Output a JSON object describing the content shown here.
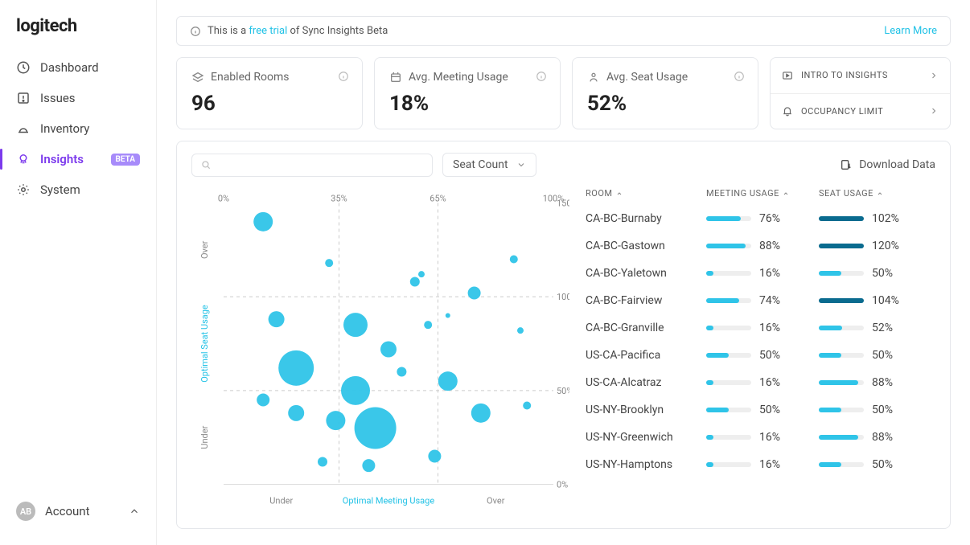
{
  "brand": "logitech",
  "sidebar": {
    "items": [
      {
        "label": "Dashboard",
        "icon": "dashboard-icon"
      },
      {
        "label": "Issues",
        "icon": "issues-icon"
      },
      {
        "label": "Inventory",
        "icon": "inventory-icon"
      },
      {
        "label": "Insights",
        "icon": "insights-icon",
        "active": true,
        "badge": "BETA"
      },
      {
        "label": "System",
        "icon": "system-icon"
      }
    ],
    "account_label": "Account",
    "account_initials": "AB"
  },
  "banner": {
    "prefix": "This is a ",
    "link": "free trial",
    "suffix": " of Sync Insights Beta",
    "learn_more": "Learn More"
  },
  "stats": [
    {
      "title": "Enabled Rooms",
      "value": "96",
      "icon": "rooms-icon"
    },
    {
      "title": "Avg. Meeting Usage",
      "value": "18%",
      "icon": "meeting-icon"
    },
    {
      "title": "Avg. Seat Usage",
      "value": "52%",
      "icon": "seat-icon"
    }
  ],
  "side_links": [
    {
      "label": "INTRO TO INSIGHTS",
      "icon": "play-icon"
    },
    {
      "label": "OCCUPANCY LIMIT",
      "icon": "bell-icon"
    }
  ],
  "panel": {
    "search_placeholder": "",
    "select_label": "Seat Count",
    "download_label": "Download Data"
  },
  "table": {
    "columns": [
      "ROOM",
      "MEETING USAGE",
      "SEAT USAGE"
    ],
    "rows": [
      {
        "room": "CA-BC-Burnaby",
        "mu": 76,
        "su": 102
      },
      {
        "room": "CA-BC-Gastown",
        "mu": 88,
        "su": 120
      },
      {
        "room": "CA-BC-Yaletown",
        "mu": 16,
        "su": 50
      },
      {
        "room": "CA-BC-Fairview",
        "mu": 74,
        "su": 104
      },
      {
        "room": "CA-BC-Granville",
        "mu": 16,
        "su": 52
      },
      {
        "room": "US-CA-Pacifica",
        "mu": 50,
        "su": 50
      },
      {
        "room": "US-CA-Alcatraz",
        "mu": 16,
        "su": 88
      },
      {
        "room": "US-NY-Brooklyn",
        "mu": 50,
        "su": 50
      },
      {
        "room": "US-NY-Greenwich",
        "mu": 16,
        "su": 88
      },
      {
        "room": "US-NY-Hamptons",
        "mu": 16,
        "su": 50
      }
    ]
  },
  "chart_data": {
    "type": "scatter",
    "title": "",
    "xlabel": "Meeting Usage",
    "ylabel": "Seat Usage",
    "x_ticks": [
      0,
      35,
      65,
      100
    ],
    "y_ticks": [
      0,
      50,
      100,
      150
    ],
    "x_region_labels": [
      "Under",
      "Optimal Meeting Usage",
      "Over"
    ],
    "y_region_labels": [
      "Under",
      "Optimal Seat Usage",
      "Over"
    ],
    "points_note": "x = meeting usage %, y = seat usage %, r = seat count (relative)",
    "points": [
      {
        "x": 12,
        "y": 140,
        "r": 12
      },
      {
        "x": 32,
        "y": 118,
        "r": 5
      },
      {
        "x": 58,
        "y": 108,
        "r": 6
      },
      {
        "x": 60,
        "y": 112,
        "r": 4
      },
      {
        "x": 76,
        "y": 102,
        "r": 8
      },
      {
        "x": 88,
        "y": 120,
        "r": 5
      },
      {
        "x": 16,
        "y": 88,
        "r": 10
      },
      {
        "x": 40,
        "y": 85,
        "r": 15
      },
      {
        "x": 62,
        "y": 85,
        "r": 5
      },
      {
        "x": 68,
        "y": 90,
        "r": 3
      },
      {
        "x": 90,
        "y": 82,
        "r": 4
      },
      {
        "x": 22,
        "y": 62,
        "r": 22
      },
      {
        "x": 50,
        "y": 72,
        "r": 10
      },
      {
        "x": 54,
        "y": 60,
        "r": 6
      },
      {
        "x": 68,
        "y": 55,
        "r": 12
      },
      {
        "x": 40,
        "y": 50,
        "r": 18
      },
      {
        "x": 12,
        "y": 45,
        "r": 8
      },
      {
        "x": 22,
        "y": 38,
        "r": 10
      },
      {
        "x": 34,
        "y": 34,
        "r": 12
      },
      {
        "x": 46,
        "y": 30,
        "r": 26
      },
      {
        "x": 78,
        "y": 38,
        "r": 12
      },
      {
        "x": 92,
        "y": 42,
        "r": 5
      },
      {
        "x": 30,
        "y": 12,
        "r": 6
      },
      {
        "x": 44,
        "y": 10,
        "r": 8
      },
      {
        "x": 64,
        "y": 15,
        "r": 8
      }
    ]
  }
}
